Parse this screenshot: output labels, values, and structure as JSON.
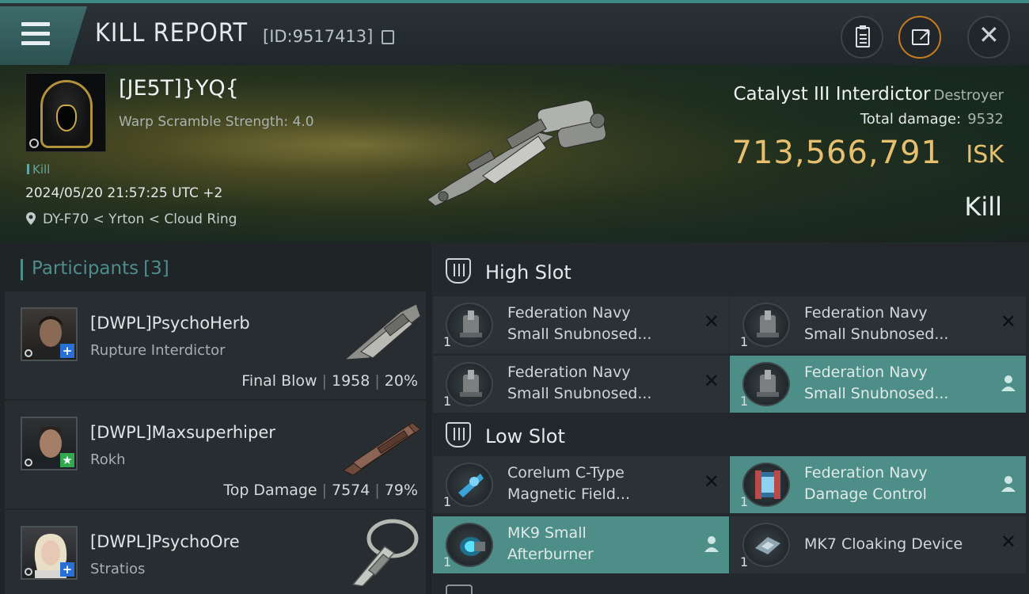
{
  "header": {
    "title": "KILL REPORT",
    "id_text": "[ID:9517413]"
  },
  "victim": {
    "name": "[JE5T]}YQ{",
    "subtitle": "Warp Scramble Strength: 4.0",
    "tag": "Kill",
    "datetime": "2024/05/20 21:57:25 UTC +2",
    "location": "DY-F70 < Yrton < Cloud Ring",
    "ship": "Catalyst III Interdictor",
    "ship_class": "Destroyer",
    "total_damage_label": "Total damage:",
    "total_damage": "9532",
    "isk_value": "713,566,791",
    "isk_unit": "ISK",
    "result": "Kill"
  },
  "participants": {
    "label": "Participants",
    "count": "[3]",
    "rows": [
      {
        "name": "[DWPL]PsychoHerb",
        "ship": "Rupture Interdictor",
        "role": "Final Blow",
        "damage": "1958",
        "percent": "20%",
        "badge": "+"
      },
      {
        "name": "[DWPL]Maxsuperhiper",
        "ship": "Rokh",
        "role": "Top Damage",
        "damage": "7574",
        "percent": "79%",
        "badge": "★"
      },
      {
        "name": "[DWPL]PsychoOre",
        "ship": "Stratios",
        "role": "",
        "damage": "",
        "percent": "",
        "badge": "+"
      }
    ]
  },
  "fitting": {
    "high_slot_label": "High Slot",
    "low_slot_label": "Low Slot",
    "high_modules": [
      {
        "line1": "Federation Navy",
        "line2": "Small Snubnosed...",
        "qty": "1",
        "status": "✕",
        "online": false
      },
      {
        "line1": "Federation Navy",
        "line2": "Small Snubnosed...",
        "qty": "1",
        "status": "✕",
        "online": false
      },
      {
        "line1": "Federation Navy",
        "line2": "Small Snubnosed...",
        "qty": "1",
        "status": "✕",
        "online": false
      },
      {
        "line1": "Federation Navy",
        "line2": "Small Snubnosed...",
        "qty": "1",
        "status": "person-icon",
        "online": true
      }
    ],
    "low_modules": [
      {
        "line1": "Corelum C-Type",
        "line2": "Magnetic Field...",
        "qty": "1",
        "status": "✕",
        "online": false
      },
      {
        "line1": "Federation Navy",
        "line2": "Damage Control",
        "qty": "1",
        "status": "person-icon",
        "online": true
      },
      {
        "line1": "MK9 Small",
        "line2": "Afterburner",
        "qty": "1",
        "status": "person-icon",
        "online": true
      },
      {
        "line1": "MK7 Cloaking Device",
        "line2": "",
        "qty": "1",
        "status": "✕",
        "online": false
      }
    ]
  },
  "colors": {
    "accent": "#4d8e88",
    "isk": "#e6c06f",
    "share_ring": "#c77b1e"
  }
}
